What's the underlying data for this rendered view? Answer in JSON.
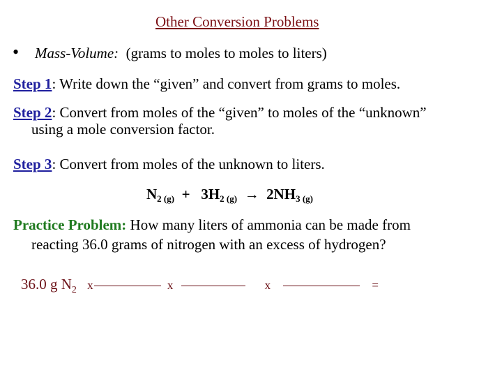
{
  "slide": {
    "title": "Other Conversion Problems",
    "bullet": {
      "symbol": "•",
      "label": "Mass-Volume:",
      "text": "(grams to moles to moles to liters)"
    },
    "steps": [
      {
        "label": "Step 1",
        "text": ": Write down the “given” and convert from grams to moles."
      },
      {
        "label": "Step 2",
        "text": ": Convert from moles of the “given” to moles of the “unknown”",
        "continuation": "using a mole conversion factor."
      },
      {
        "label": "Step 3",
        "text": ":  Convert from moles of the unknown to liters."
      }
    ],
    "equation": {
      "r1": "N",
      "r1_sub": "2 (g)",
      "plus": "+",
      "r2": "3H",
      "r2_sub": "2 (g)",
      "arrow": "→",
      "p1": "2NH",
      "p1_sub": "3 (g)"
    },
    "practice": {
      "label": "Practice Problem:",
      "text": " How many liters of ammonia can be made from",
      "continuation": "reacting 36.0 grams of nitrogen with an excess of hydrogen?"
    },
    "calculation": {
      "given": "36.0 g N",
      "given_sub": "2",
      "times": "x",
      "equals": "="
    }
  },
  "colors": {
    "title": "#7b0f14",
    "step_label": "#1f1f9e",
    "practice_label": "#1f7a1f",
    "calculation": "#6b1016"
  }
}
